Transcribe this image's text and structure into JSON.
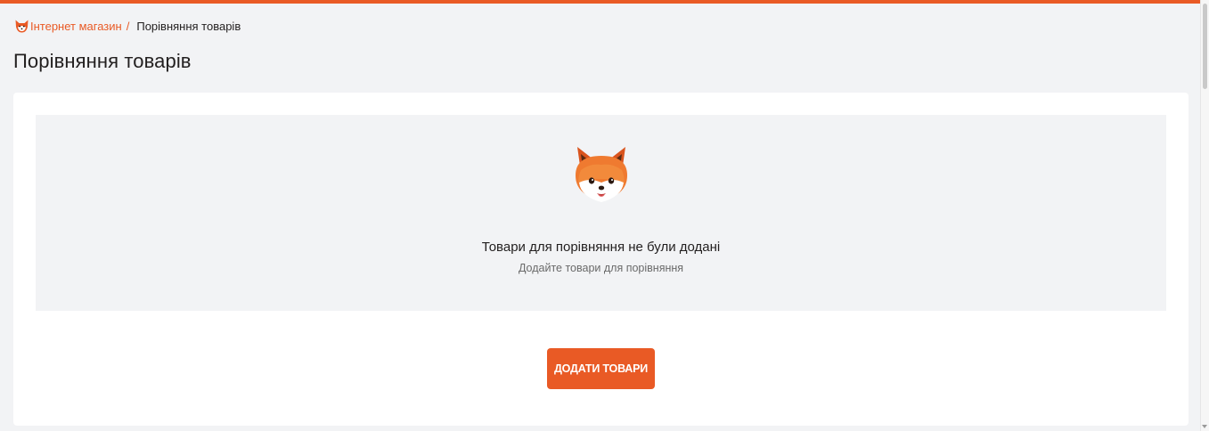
{
  "colors": {
    "accent": "#e95a25",
    "page_background": "#f2f3f5",
    "card_background": "#ffffff",
    "text_primary": "#221f1f",
    "text_secondary": "#6a6a6a"
  },
  "breadcrumb": {
    "home_icon": "fox-logo-icon",
    "home_label": "Інтернет магазин",
    "separator": "/",
    "current_label": "Порівняння товарів"
  },
  "page": {
    "title": "Порівняння товарів"
  },
  "empty_state": {
    "icon": "fox-icon",
    "title": "Товари для порівняння не були додані",
    "subtitle": "Додайте товари для порівняння"
  },
  "actions": {
    "add_products_label": "ДОДАТИ ТОВАРИ"
  }
}
